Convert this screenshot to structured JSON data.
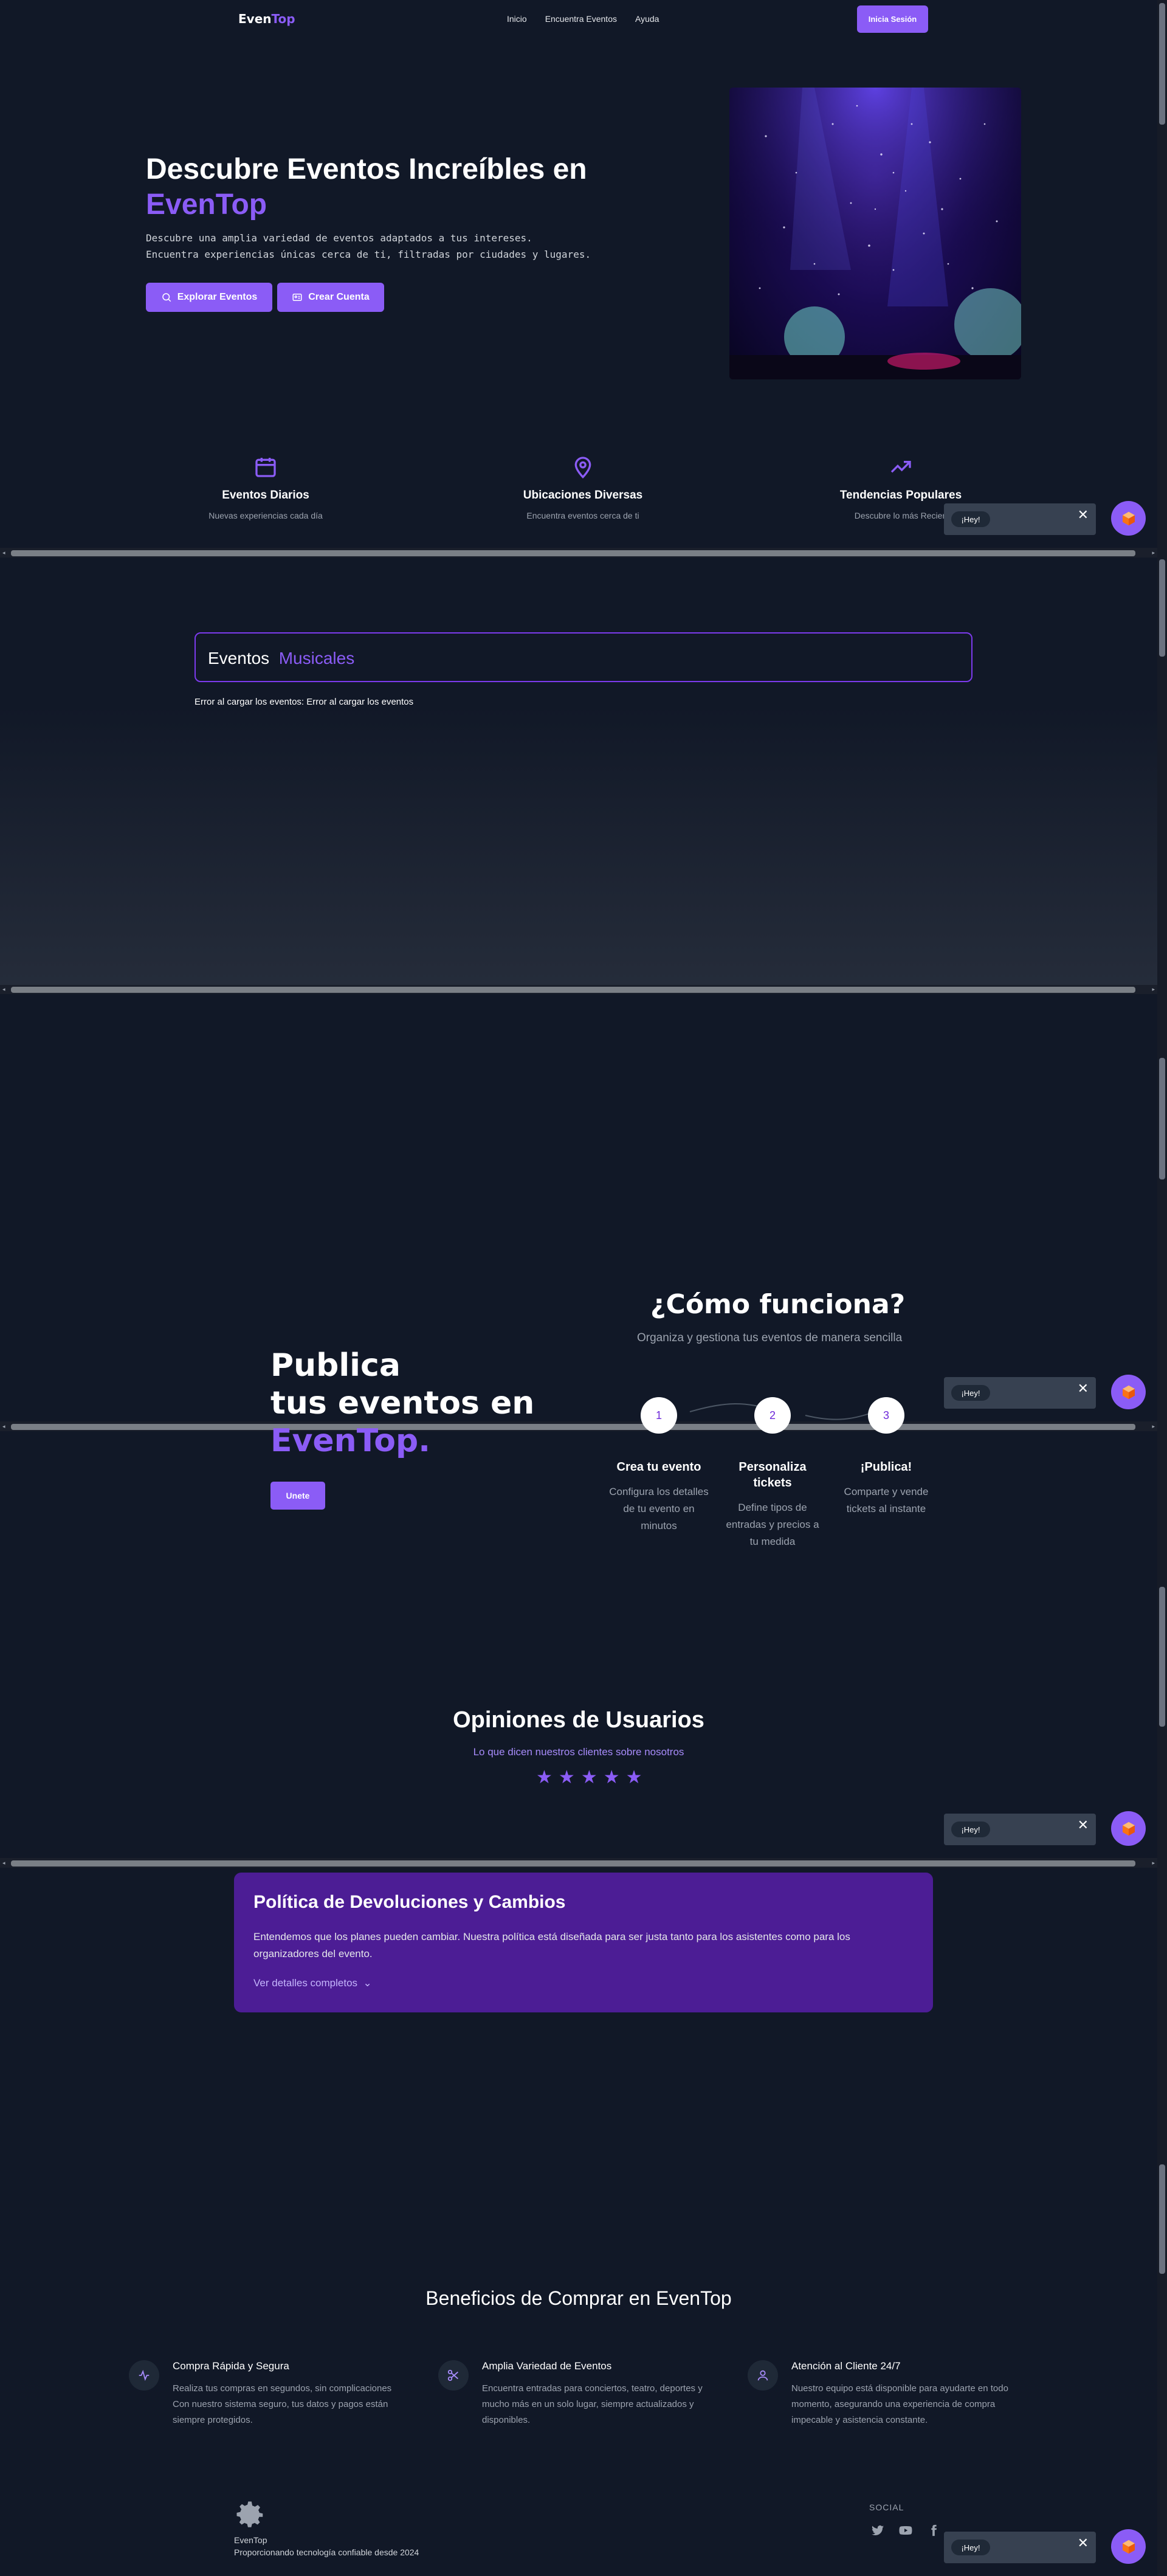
{
  "nav": {
    "logo_a": "Even",
    "logo_b": "Top",
    "links": [
      "Inicio",
      "Encuentra Eventos",
      "Ayuda"
    ],
    "login": "Inicia Sesión"
  },
  "hero": {
    "title_line1": "Descubre Eventos Increíbles en",
    "title_brand": "EvenTop",
    "desc_line1": "Descubre una amplia variedad de eventos adaptados a tus intereses.",
    "desc_line2": "Encuentra experiencias únicas cerca de ti, filtradas por ciudades y lugares.",
    "explore": "Explorar Eventos",
    "create": "Crear Cuenta"
  },
  "features": [
    {
      "title": "Eventos Diarios",
      "desc": "Nuevas experiencias cada día",
      "icon": "calendar-icon"
    },
    {
      "title": "Ubicaciones Diversas",
      "desc": "Encuentra eventos cerca de ti",
      "icon": "map-pin-icon"
    },
    {
      "title": "Tendencias Populares",
      "desc": "Descubre lo más Recien",
      "icon": "trending-up-icon"
    }
  ],
  "chat": {
    "greeting": "¡Hey!",
    "close": "✕"
  },
  "musical": {
    "title_a": "Eventos",
    "title_b": "Musicales",
    "error": "Error al cargar los eventos: Error al cargar los eventos"
  },
  "publish": {
    "line1": "Publica",
    "line2": "tus eventos en",
    "brand": "EvenTop.",
    "button": "Unete"
  },
  "how": {
    "title": "¿Cómo funciona?",
    "subtitle": "Organiza y gestiona tus eventos de manera sencilla",
    "steps": [
      {
        "num": "1",
        "title": "Crea tu evento",
        "desc": "Configura los detalles de tu evento en minutos"
      },
      {
        "num": "2",
        "title": "Personaliza tickets",
        "desc": "Define tipos de entradas y precios a tu medida"
      },
      {
        "num": "3",
        "title": "¡Publica!",
        "desc": "Comparte y vende tickets al instante"
      }
    ]
  },
  "opinions": {
    "title": "Opiniones de Usuarios",
    "subtitle": "Lo que dicen nuestros clientes sobre nosotros",
    "rating": 5
  },
  "policy": {
    "title": "Política de Devoluciones y Cambios",
    "text": "Entendemos que los planes pueden cambiar. Nuestra política está diseñada para ser justa tanto para los asistentes como para los organizadores del evento.",
    "link": "Ver detalles completos"
  },
  "benefits": {
    "title": "Beneficios de Comprar en EvenTop",
    "items": [
      {
        "title": "Compra Rápida y Segura",
        "desc": "Realiza tus compras en segundos, sin complicaciones Con nuestro sistema seguro, tus datos y pagos están siempre protegidos.",
        "icon": "activity-icon"
      },
      {
        "title": "Amplia Variedad de Eventos",
        "desc": "Encuentra entradas para conciertos, teatro, deportes y mucho más en un solo lugar, siempre actualizados y disponibles.",
        "icon": "scissors-icon"
      },
      {
        "title": "Atención al Cliente 24/7",
        "desc": "Nuestro equipo está disponible para ayudarte en todo momento, asegurando una experiencia de compra impecable y asistencia constante.",
        "icon": "user-icon"
      }
    ]
  },
  "footer": {
    "name": "EvenTop",
    "tagline": "Proporcionando tecnología confiable desde 2024",
    "social_label": "SOCIAL"
  },
  "colors": {
    "accent": "#8b5cf6",
    "background": "#111827",
    "policy_bg": "#4c1d95"
  }
}
